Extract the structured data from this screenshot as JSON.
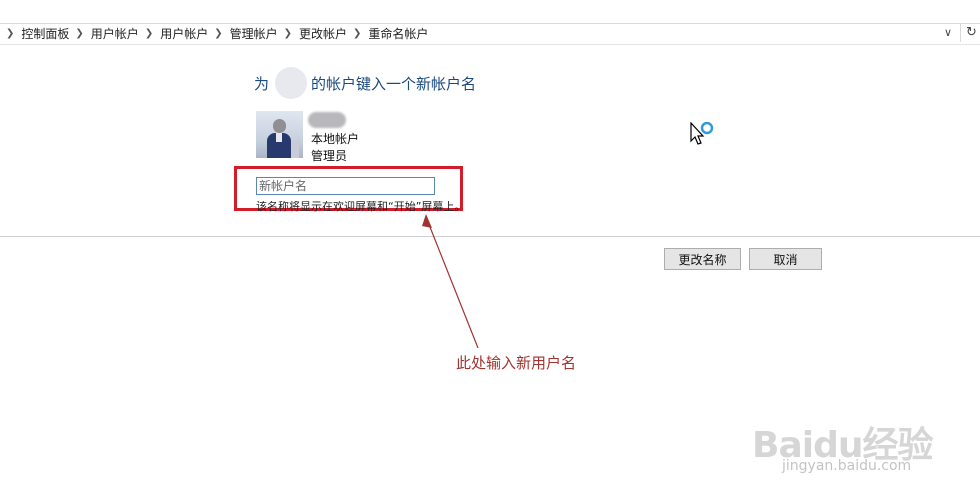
{
  "breadcrumb": [
    "控制面板",
    "用户帐户",
    "用户帐户",
    "管理帐户",
    "更改帐户",
    "重命名帐户"
  ],
  "heading": {
    "prefix": "为",
    "suffix": "的帐户键入一个新帐户名"
  },
  "account": {
    "type": "本地帐户",
    "role": "管理员"
  },
  "new_name": {
    "value": "",
    "placeholder": "新帐户名"
  },
  "hint_text": "该名称将显示在欢迎屏幕和“开始”屏幕上。",
  "buttons": {
    "rename": "更改名称",
    "cancel": "取消"
  },
  "annotation": "此处输入新用户名",
  "watermark": {
    "logo": "Baidu经验",
    "url": "jingyan.baidu.com"
  },
  "colors": {
    "heading": "#1a4a82",
    "highlight": "#d21d28",
    "annotation": "#a2332f"
  }
}
